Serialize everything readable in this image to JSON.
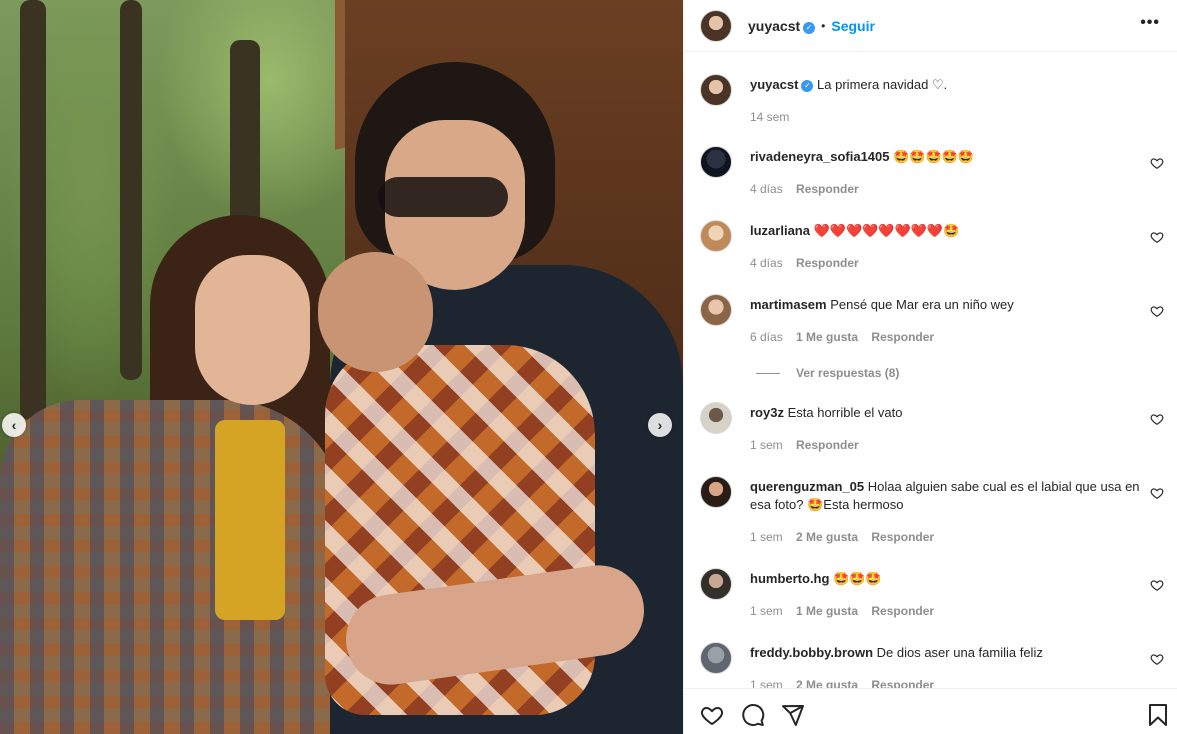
{
  "post": {
    "author": "yuyacst",
    "follow_label": "Seguir",
    "dot": "•",
    "more": "•••",
    "verified_mark": "✓",
    "caption": "La primera navidad ♡.",
    "time": "14 sem"
  },
  "carousel": {
    "prev": "‹",
    "next": "›"
  },
  "comments": [
    {
      "user": "rivadeneyra_sofia1405",
      "text": "🤩🤩🤩🤩🤩",
      "time": "4 días",
      "likes": "",
      "reply": "Responder"
    },
    {
      "user": "luzarliana",
      "text": "❤️❤️❤️❤️❤️❤️❤️❤️🤩",
      "time": "4 días",
      "likes": "",
      "reply": "Responder"
    },
    {
      "user": "martimasem",
      "text": "Pensé que Mar era un niño wey",
      "time": "6 días",
      "likes": "1 Me gusta",
      "reply": "Responder",
      "view_replies": "Ver respuestas (8)"
    },
    {
      "user": "roy3z",
      "text": "Esta horrible el vato",
      "time": "1 sem",
      "likes": "",
      "reply": "Responder"
    },
    {
      "user": "querenguzman_05",
      "text": "Holaa alguien sabe cual es el labial que usa en esa foto? 🤩Esta hermoso",
      "time": "1 sem",
      "likes": "2 Me gusta",
      "reply": "Responder"
    },
    {
      "user": "humberto.hg",
      "text": "🤩🤩🤩",
      "time": "1 sem",
      "likes": "1 Me gusta",
      "reply": "Responder"
    },
    {
      "user": "freddy.bobby.brown",
      "text": "De dios aser una familia feliz",
      "time": "1 sem",
      "likes": "2 Me gusta",
      "reply": "Responder"
    }
  ],
  "icons": {
    "like": "heart-icon",
    "comment": "comment-icon",
    "share": "share-icon",
    "save": "bookmark-icon"
  },
  "colors": {
    "link": "#0095f6",
    "verified": "#3897f0",
    "muted": "#8e8e8e",
    "text": "#262626"
  }
}
